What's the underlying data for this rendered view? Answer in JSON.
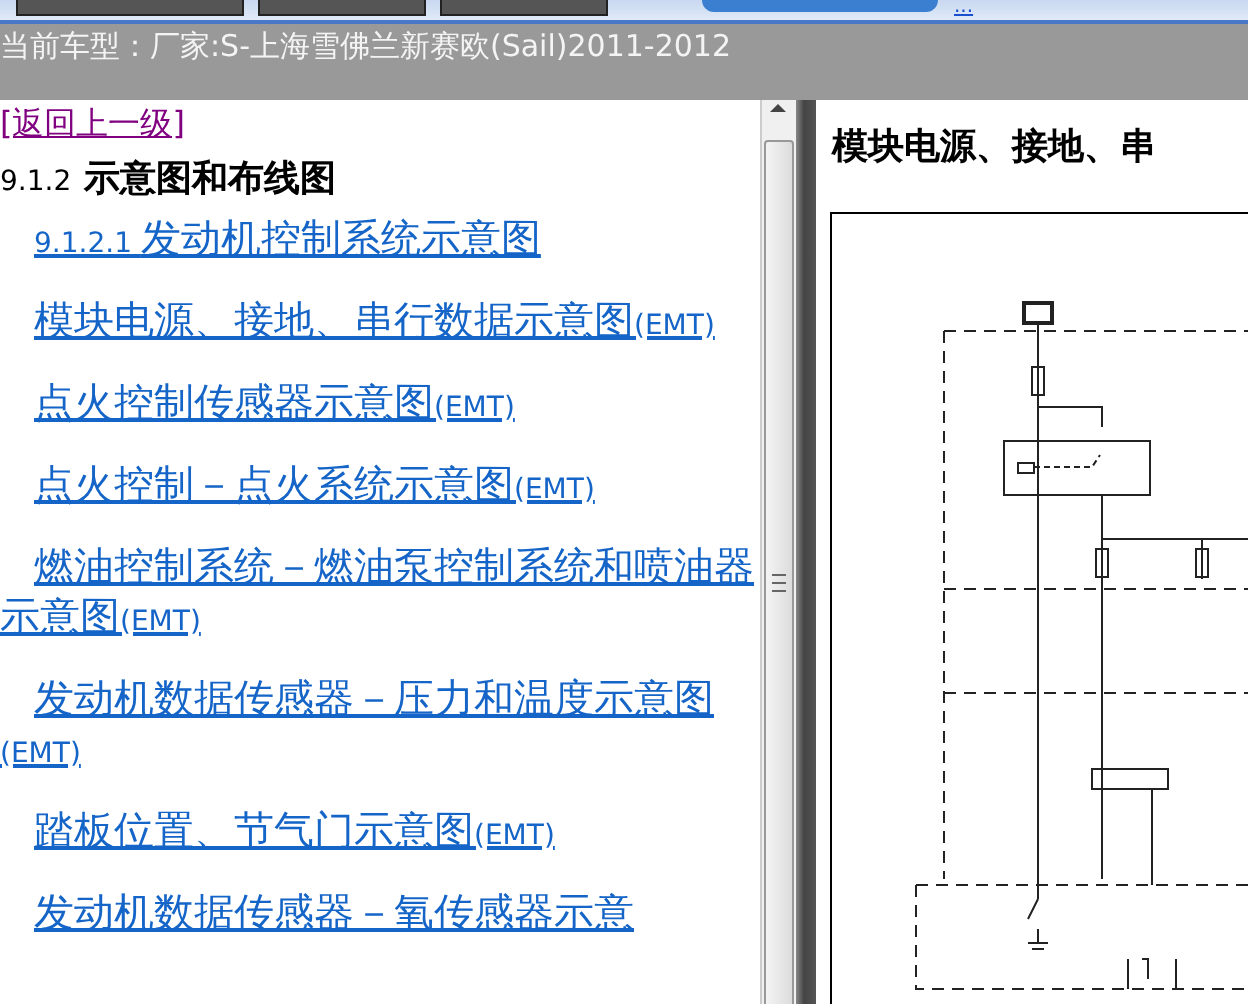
{
  "top_bar": {
    "link": "..."
  },
  "header": {
    "title": "当前车型：厂家:S-上海雪佛兰新赛欧(Sail)2011-2012"
  },
  "toc": {
    "back_link": "[返回上一级]",
    "heading_number": "9.1.2",
    "heading": "示意图和布线图",
    "items": [
      {
        "number": "9.1.2.1",
        "text": "发动机控制系统示意图"
      },
      {
        "text": "模块电源、接地、串行数据示意图",
        "suffix": "(EMT)"
      },
      {
        "text": "点火控制传感器示意图",
        "suffix": "(EMT)"
      },
      {
        "text": "点火控制－点火系统示意图",
        "suffix": "(EMT)"
      },
      {
        "text": "燃油控制系统－燃油泵控制系统和喷油器示意图",
        "suffix": "(EMT)"
      },
      {
        "text": "发动机数据传感器－压力和温度示意图",
        "suffix": "(EMT)"
      },
      {
        "text": "踏板位置、节气门示意图",
        "suffix": "(EMT)"
      },
      {
        "text": "发动机数据传感器－氧传感器示意"
      }
    ]
  },
  "document": {
    "title": "模块电源、接地、串"
  }
}
